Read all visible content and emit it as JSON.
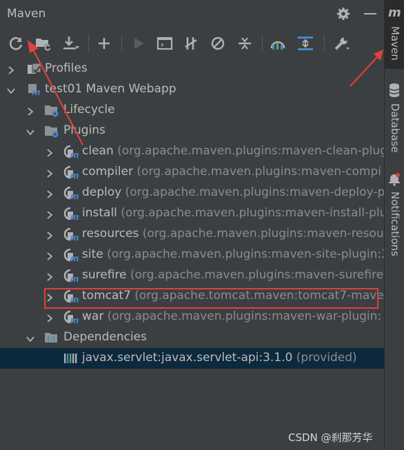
{
  "panel": {
    "title": "Maven"
  },
  "toolbar": {
    "buttons": [
      {
        "name": "reload-all-maven-projects-button",
        "icon": "refresh-icon"
      },
      {
        "name": "generate-sources-button",
        "icon": "folder-refresh-icon"
      },
      {
        "name": "download-sources-button",
        "icon": "download-icon"
      },
      {
        "name": "add-maven-project-button",
        "icon": "plus-icon"
      },
      {
        "name": "run-maven-build-button",
        "icon": "play-icon"
      },
      {
        "name": "execute-maven-goal-button",
        "icon": "terminal-icon"
      },
      {
        "name": "toggle-offline-mode-button",
        "icon": "offline-icon"
      },
      {
        "name": "skip-tests-button",
        "icon": "skip-icon"
      },
      {
        "name": "collapse-all-button",
        "icon": "collapse-icon"
      },
      {
        "name": "show-dependencies-button",
        "icon": "diagram-icon"
      },
      {
        "name": "expand-all-button",
        "icon": "expand-icon"
      },
      {
        "name": "maven-settings-button",
        "icon": "wrench-icon"
      }
    ]
  },
  "tree": {
    "profiles": "Profiles",
    "project": "test01 Maven Webapp",
    "lifecycle": "Lifecycle",
    "plugins": "Plugins",
    "plugin_items": [
      {
        "name": "clean",
        "coord": "(org.apache.maven.plugins:maven-clean-plug"
      },
      {
        "name": "compiler",
        "coord": "(org.apache.maven.plugins:maven-compi"
      },
      {
        "name": "deploy",
        "coord": "(org.apache.maven.plugins:maven-deploy-p"
      },
      {
        "name": "install",
        "coord": "(org.apache.maven.plugins:maven-install-plu"
      },
      {
        "name": "resources",
        "coord": "(org.apache.maven.plugins:maven-resour"
      },
      {
        "name": "site",
        "coord": "(org.apache.maven.plugins:maven-site-plugin:3"
      },
      {
        "name": "surefire",
        "coord": "(org.apache.maven.plugins:maven-surefire-"
      },
      {
        "name": "tomcat7",
        "coord": "(org.apache.tomcat.maven:tomcat7-mave"
      },
      {
        "name": "war",
        "coord": "(org.apache.maven.plugins:maven-war-plugin:"
      }
    ],
    "dependencies": "Dependencies",
    "dependency_items": [
      {
        "name": "javax.servlet:javax.servlet-api:3.1.0",
        "scope": "(provided)"
      }
    ]
  },
  "sidebar": {
    "tabs": [
      {
        "label": "Maven",
        "icon": "maven-icon",
        "active": true
      },
      {
        "label": "Database",
        "icon": "database-icon",
        "active": false
      },
      {
        "label": "Notifications",
        "icon": "bell-icon",
        "active": false
      }
    ]
  },
  "watermark": "CSDN @刹那芳华",
  "colors": {
    "background": "#3c3f41",
    "selection": "#0d293e",
    "highlight_box": "#e0403e",
    "annotation_arrow": "#e0403e"
  }
}
